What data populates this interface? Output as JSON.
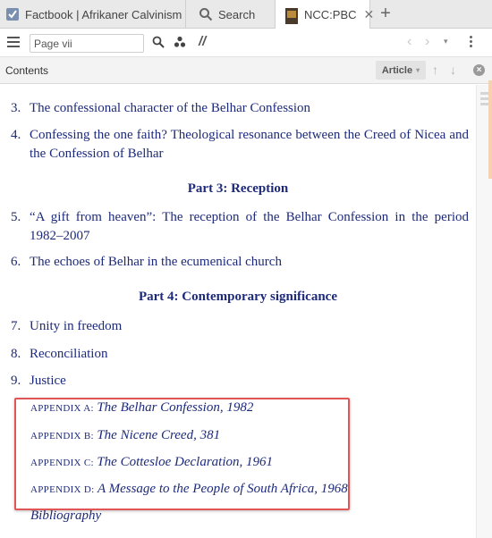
{
  "tabs": [
    {
      "label": "Factbook | Afrikaner Calvinism",
      "icon": "checkbox-icon"
    },
    {
      "label": "Search",
      "icon": "search-icon"
    },
    {
      "label": "NCC:PBC",
      "icon": "book-icon",
      "close": "✕"
    }
  ],
  "tab_add": "+",
  "toolbar": {
    "page_value": "Page vii",
    "slash": "//"
  },
  "panel": {
    "title": "Contents",
    "article_label": "Article"
  },
  "toc": {
    "items": [
      {
        "num": "3.",
        "text": "The confessional character of the Belhar Confession"
      },
      {
        "num": "4.",
        "text": "Confessing the one faith? Theological resonance between the Creed of Nicea and the Confession of Belhar"
      },
      {
        "num": "5.",
        "text": "“A gift from heaven”: The reception of the Belhar Confession in the period 1982–2007"
      },
      {
        "num": "6.",
        "text": "The echoes of Belhar in the ecumenical church"
      },
      {
        "num": "7.",
        "text": "Unity in freedom"
      },
      {
        "num": "8.",
        "text": "Reconciliation"
      },
      {
        "num": "9.",
        "text": "Justice"
      }
    ],
    "parts": [
      "Part 3: Reception",
      "Part 4: Contemporary significance"
    ],
    "appendices": [
      {
        "label": "APPENDIX A:",
        "title": "The Belhar Confession, 1982"
      },
      {
        "label": "APPENDIX B:",
        "title": "The Nicene Creed, 381"
      },
      {
        "label": "APPENDIX C:",
        "title": "The Cottesloe Declaration, 1961"
      },
      {
        "label": "APPENDIX D:",
        "title": "A Message to the People of South Africa, 1968"
      }
    ],
    "bibliography": "Bibliography"
  },
  "colors": {
    "text": "#1d2a7a",
    "highlight": "#e05656"
  }
}
